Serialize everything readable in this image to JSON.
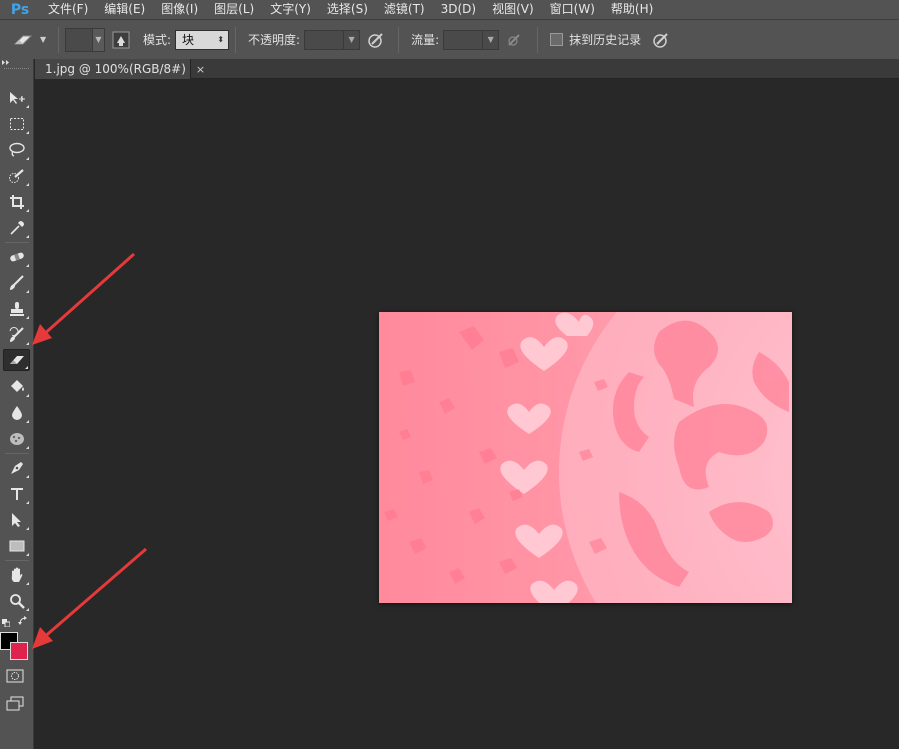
{
  "app": {
    "logo": "Ps",
    "accent": "#3fa5e8"
  },
  "menu": {
    "items": [
      "文件(F)",
      "编辑(E)",
      "图像(I)",
      "图层(L)",
      "文字(Y)",
      "选择(S)",
      "滤镜(T)",
      "3D(D)",
      "视图(V)",
      "窗口(W)",
      "帮助(H)"
    ]
  },
  "options": {
    "mode_label": "模式:",
    "mode_value": "块",
    "opacity_label": "不透明度:",
    "opacity_value": "",
    "flow_label": "流量:",
    "flow_value": "",
    "history_label": "抹到历史记录"
  },
  "document": {
    "tab_title": "1.jpg @ 100%(RGB/8#)",
    "close_symbol": "×"
  },
  "colors": {
    "foreground": "#000000",
    "background": "#e0234e",
    "image_base": "#ff8fa0",
    "annotation_arrow": "#e63a3a"
  },
  "tools": [
    "move-tool",
    "marquee-tool",
    "lasso-tool",
    "quick-selection-tool",
    "crop-tool",
    "eyedropper-tool",
    "spot-healing-tool",
    "brush-tool",
    "clone-stamp-tool",
    "history-brush-tool",
    "eraser-tool",
    "paint-bucket-tool",
    "blur-tool",
    "dodge-tool",
    "pen-tool",
    "type-tool",
    "path-selection-tool",
    "rectangle-tool",
    "hand-tool",
    "zoom-tool"
  ],
  "active_tool": "eraser-tool"
}
